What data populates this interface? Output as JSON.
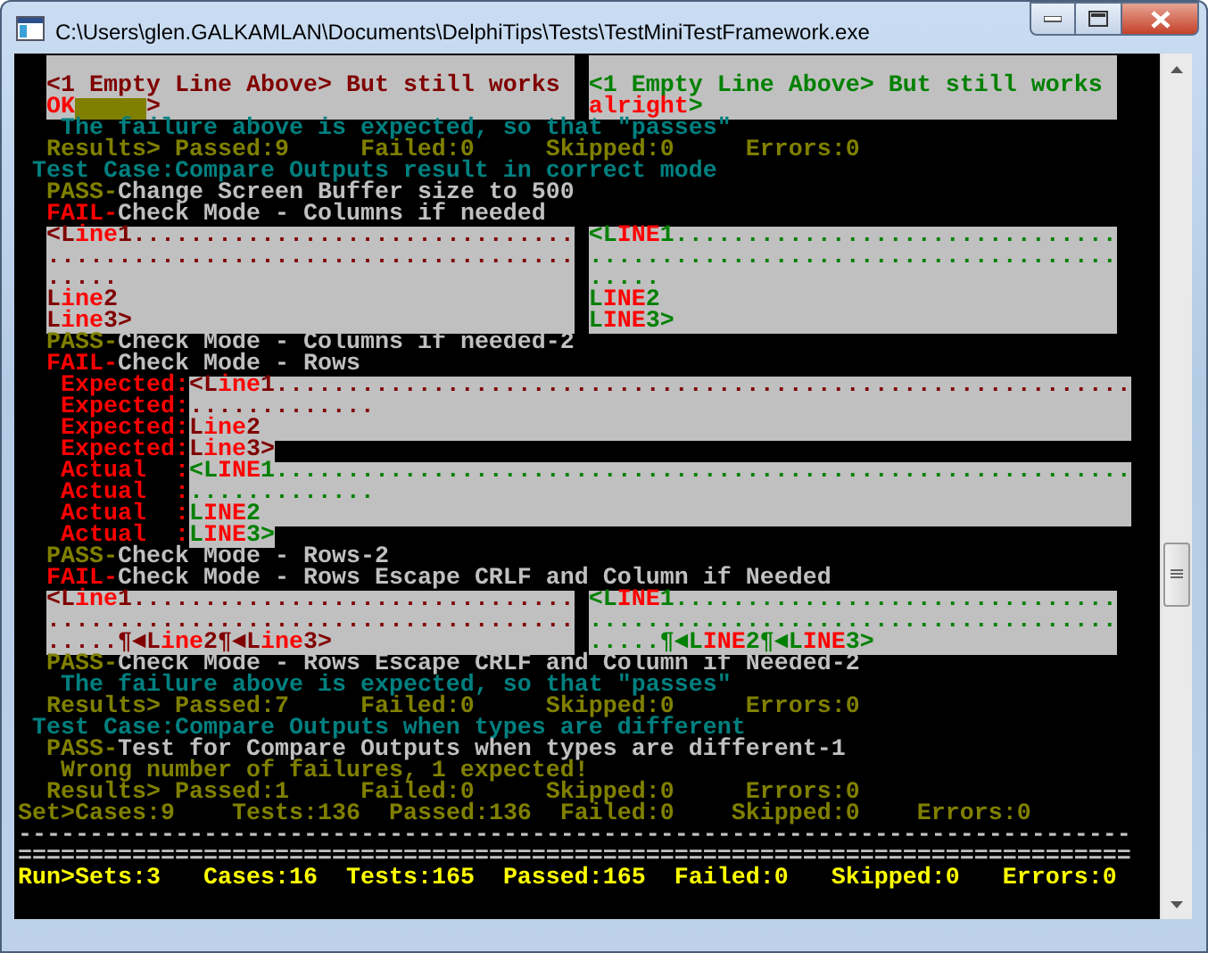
{
  "window": {
    "title": "C:\\Users\\glen.GALKAMLAN\\Documents\\DelphiTips\\Tests\\TestMiniTestFramework.exe"
  },
  "console": {
    "lines": [
      {
        "kind": "compare",
        "left": [
          {
            "kind": "blank"
          },
          {
            "kind": "text",
            "segments": [
              {
                "text": "<1 Empty Line Above> But still works",
                "color": "#800000"
              }
            ]
          },
          {
            "kind": "text",
            "segments": [
              {
                "text": "OK",
                "color": "#ff0000"
              },
              {
                "kind": "fill",
                "color": "#808000"
              },
              {
                "text": ">",
                "color": "#800000"
              }
            ]
          }
        ],
        "right": [
          {
            "kind": "blank"
          },
          {
            "kind": "text",
            "segments": [
              {
                "text": "<1 Empty Line Above> But still works",
                "color": "#008000"
              }
            ]
          },
          {
            "kind": "text",
            "segments": [
              {
                "text": "alright",
                "color": "#ff0000"
              },
              {
                "text": ">",
                "color": "#008000"
              }
            ]
          }
        ]
      },
      {
        "kind": "note",
        "segments": [
          {
            "text": "The failure above is expected, so that \"passes\"",
            "color": "#008080"
          }
        ]
      },
      {
        "kind": "test",
        "segments": [
          {
            "text": "Results> Passed:9     Failed:0     Skipped:0     Errors:0",
            "color": "#808000"
          }
        ]
      },
      {
        "kind": "case",
        "segments": [
          {
            "text": "Test Case:Compare Outputs result in correct mode",
            "color": "#008080"
          }
        ]
      },
      {
        "kind": "test",
        "segments": [
          {
            "text": "PASS-",
            "color": "#808000"
          },
          {
            "text": "Change Screen Buffer size to 500",
            "color": "#c0c0c0"
          }
        ]
      },
      {
        "kind": "test",
        "segments": [
          {
            "text": "FAIL-",
            "color": "#ff0000"
          },
          {
            "text": "Check Mode - Columns if needed",
            "color": "#c0c0c0"
          }
        ]
      },
      {
        "kind": "compare",
        "left": [
          {
            "kind": "text",
            "segments": [
              {
                "text": "<L",
                "color": "#800000"
              },
              {
                "text": "ine",
                "color": "#ff0000"
              },
              {
                "text": "1...............................",
                "color": "#800000"
              }
            ]
          },
          {
            "kind": "text",
            "segments": [
              {
                "text": ".....................................",
                "color": "#800000"
              }
            ]
          },
          {
            "kind": "text",
            "segments": [
              {
                "text": ".....",
                "color": "#800000"
              }
            ]
          },
          {
            "kind": "text",
            "segments": [
              {
                "text": "L",
                "color": "#800000"
              },
              {
                "text": "ine",
                "color": "#ff0000"
              },
              {
                "text": "2",
                "color": "#800000"
              }
            ]
          },
          {
            "kind": "text",
            "segments": [
              {
                "text": "L",
                "color": "#800000"
              },
              {
                "text": "ine",
                "color": "#ff0000"
              },
              {
                "text": "3>",
                "color": "#800000"
              }
            ]
          }
        ],
        "right": [
          {
            "kind": "text",
            "segments": [
              {
                "text": "<L",
                "color": "#008000"
              },
              {
                "text": "INE",
                "color": "#ff0000"
              },
              {
                "text": "1...............................",
                "color": "#008000"
              }
            ]
          },
          {
            "kind": "text",
            "segments": [
              {
                "text": ".....................................",
                "color": "#008000"
              }
            ]
          },
          {
            "kind": "text",
            "segments": [
              {
                "text": ".....",
                "color": "#008000"
              }
            ]
          },
          {
            "kind": "text",
            "segments": [
              {
                "text": "L",
                "color": "#008000"
              },
              {
                "text": "INE",
                "color": "#ff0000"
              },
              {
                "text": "2",
                "color": "#008000"
              }
            ]
          },
          {
            "kind": "text",
            "segments": [
              {
                "text": "L",
                "color": "#008000"
              },
              {
                "text": "INE",
                "color": "#ff0000"
              },
              {
                "text": "3>",
                "color": "#008000"
              }
            ]
          }
        ]
      },
      {
        "kind": "test",
        "segments": [
          {
            "text": "PASS-",
            "color": "#808000"
          },
          {
            "text": "Check Mode - Columns if needed-2",
            "color": "#c0c0c0"
          }
        ]
      },
      {
        "kind": "test",
        "segments": [
          {
            "text": "FAIL-",
            "color": "#ff0000"
          },
          {
            "text": "Check Mode - Rows",
            "color": "#c0c0c0"
          }
        ]
      },
      {
        "kind": "rows",
        "lines": [
          {
            "label": "Expected:",
            "full_width": true,
            "segments": [
              {
                "text": "<L",
                "color": "#800000"
              },
              {
                "text": "ine",
                "color": "#ff0000"
              },
              {
                "text": "1............................................................",
                "color": "#800000"
              }
            ]
          },
          {
            "label": "Expected:",
            "full_width": true,
            "segments": [
              {
                "text": ".............",
                "color": "#800000"
              }
            ]
          },
          {
            "label": "Expected:",
            "full_width": true,
            "segments": [
              {
                "text": "L",
                "color": "#800000"
              },
              {
                "text": "ine",
                "color": "#ff0000"
              },
              {
                "text": "2",
                "color": "#800000"
              }
            ]
          },
          {
            "label": "Expected:",
            "full_width": false,
            "segments": [
              {
                "text": "L",
                "color": "#800000"
              },
              {
                "text": "ine",
                "color": "#ff0000"
              },
              {
                "text": "3>",
                "color": "#800000"
              }
            ]
          },
          {
            "label": "Actual  :",
            "full_width": true,
            "segments": [
              {
                "text": "<L",
                "color": "#008000"
              },
              {
                "text": "INE",
                "color": "#ff0000"
              },
              {
                "text": "1............................................................",
                "color": "#008000"
              }
            ]
          },
          {
            "label": "Actual  :",
            "full_width": true,
            "segments": [
              {
                "text": ".............",
                "color": "#008000"
              }
            ]
          },
          {
            "label": "Actual  :",
            "full_width": true,
            "segments": [
              {
                "text": "L",
                "color": "#008000"
              },
              {
                "text": "INE",
                "color": "#ff0000"
              },
              {
                "text": "2",
                "color": "#008000"
              }
            ]
          },
          {
            "label": "Actual  :",
            "full_width": false,
            "segments": [
              {
                "text": "L",
                "color": "#008000"
              },
              {
                "text": "INE",
                "color": "#ff0000"
              },
              {
                "text": "3>",
                "color": "#008000"
              }
            ]
          }
        ]
      },
      {
        "kind": "test",
        "segments": [
          {
            "text": "PASS-",
            "color": "#808000"
          },
          {
            "text": "Check Mode - Rows-2",
            "color": "#c0c0c0"
          }
        ]
      },
      {
        "kind": "test",
        "segments": [
          {
            "text": "FAIL-",
            "color": "#ff0000"
          },
          {
            "text": "Check Mode - Rows Escape CRLF and Column if Needed",
            "color": "#c0c0c0"
          }
        ]
      },
      {
        "kind": "compare",
        "left": [
          {
            "kind": "text",
            "segments": [
              {
                "text": "<L",
                "color": "#800000"
              },
              {
                "text": "ine",
                "color": "#ff0000"
              },
              {
                "text": "1...............................",
                "color": "#800000"
              }
            ]
          },
          {
            "kind": "text",
            "segments": [
              {
                "text": ".....................................",
                "color": "#800000"
              }
            ]
          },
          {
            "kind": "text",
            "segments": [
              {
                "text": ".....¶◄L",
                "color": "#800000"
              },
              {
                "text": "ine",
                "color": "#ff0000"
              },
              {
                "text": "2¶◄L",
                "color": "#800000"
              },
              {
                "text": "ine",
                "color": "#ff0000"
              },
              {
                "text": "3>",
                "color": "#800000"
              }
            ]
          }
        ],
        "right": [
          {
            "kind": "text",
            "segments": [
              {
                "text": "<L",
                "color": "#008000"
              },
              {
                "text": "INE",
                "color": "#ff0000"
              },
              {
                "text": "1...............................",
                "color": "#008000"
              }
            ]
          },
          {
            "kind": "text",
            "segments": [
              {
                "text": ".....................................",
                "color": "#008000"
              }
            ]
          },
          {
            "kind": "text",
            "segments": [
              {
                "text": ".....¶◄L",
                "color": "#008000"
              },
              {
                "text": "INE",
                "color": "#ff0000"
              },
              {
                "text": "2¶◄L",
                "color": "#008000"
              },
              {
                "text": "INE",
                "color": "#ff0000"
              },
              {
                "text": "3>",
                "color": "#008000"
              }
            ]
          }
        ]
      },
      {
        "kind": "test",
        "segments": [
          {
            "text": "PASS-",
            "color": "#808000"
          },
          {
            "text": "Check Mode - Rows Escape CRLF and Column if Needed-2",
            "color": "#c0c0c0"
          }
        ]
      },
      {
        "kind": "note",
        "segments": [
          {
            "text": "The failure above is expected, so that \"passes\"",
            "color": "#008080"
          }
        ]
      },
      {
        "kind": "test",
        "segments": [
          {
            "text": "Results> Passed:7     Failed:0     Skipped:0     Errors:0",
            "color": "#808000"
          }
        ]
      },
      {
        "kind": "case",
        "segments": [
          {
            "text": "Test Case:Compare Outputs when types are different",
            "color": "#008080"
          }
        ]
      },
      {
        "kind": "test",
        "segments": [
          {
            "text": "PASS-",
            "color": "#808000"
          },
          {
            "text": "Test for Compare Outputs when types are different-1",
            "color": "#c0c0c0"
          }
        ]
      },
      {
        "kind": "note",
        "segments": [
          {
            "text": "Wrong number of failures, 1 expected!",
            "color": "#808000"
          }
        ]
      },
      {
        "kind": "test",
        "segments": [
          {
            "text": "Results> Passed:1     Failed:0     Skipped:0     Errors:0",
            "color": "#808000"
          }
        ]
      },
      {
        "kind": "run",
        "segments": [
          {
            "text": "Set>Cases:9    Tests:136  Passed:136  Failed:0    Skipped:0    Errors:0",
            "color": "#808000"
          }
        ]
      },
      {
        "kind": "run",
        "segments": [
          {
            "text": "------------------------------------------------------------------------------",
            "color": "#c0c0c0"
          }
        ]
      },
      {
        "kind": "run",
        "segments": [
          {
            "text": "==============================================================================",
            "color": "#c0c0c0"
          }
        ]
      },
      {
        "kind": "run",
        "segments": [
          {
            "text": "Run>Sets:3   Cases:16  Tests:165  Passed:165  Failed:0   Skipped:0   Errors:0",
            "color": "#ffff00"
          }
        ]
      }
    ]
  }
}
